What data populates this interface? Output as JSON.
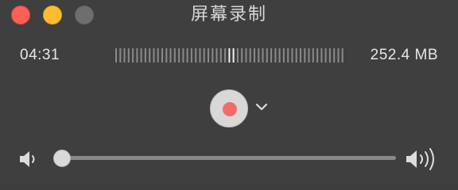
{
  "window": {
    "title": "屏幕录制"
  },
  "colors": {
    "close": "#fe5f57",
    "minimize": "#febc2e",
    "maximize": "#6e6e6e",
    "record_dot": "#f26b6b",
    "background": "#3f3f3f"
  },
  "recording": {
    "elapsed_time": "04:31",
    "file_size": "252.4 MB",
    "audio_level_ticks": 55,
    "playhead_fraction": 0.5
  },
  "volume": {
    "level_fraction": 0.0,
    "low_icon": "speaker-low-icon",
    "high_icon": "speaker-high-icon"
  },
  "controls": {
    "record_icon": "record-icon",
    "options_icon": "chevron-down-icon"
  }
}
